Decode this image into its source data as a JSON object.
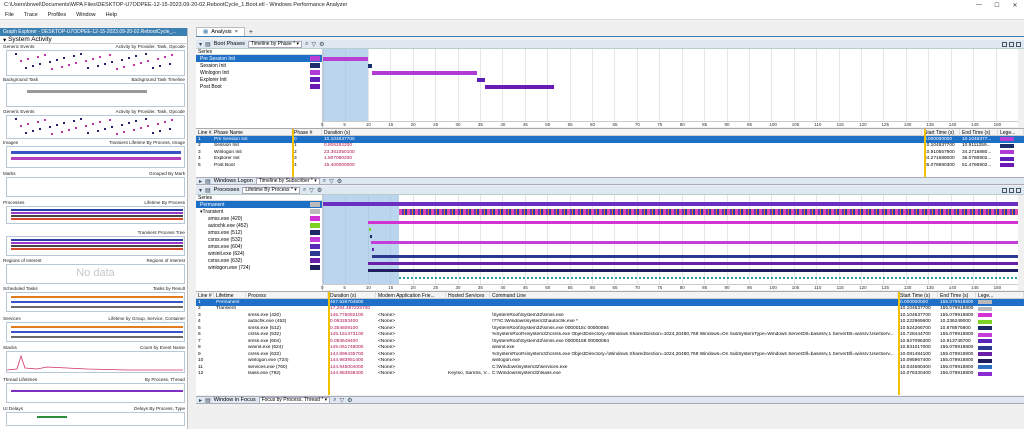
{
  "window": {
    "title": "C:\\Users\\brwel\\Documents\\WPA Files\\DESKTOP-U7ODPEE-12-15-2023.09-20-02.RebootCycle_1.Boot.etl - Windows Performance Analyzer",
    "minimize": "—",
    "maximize": "☐",
    "close": "✕"
  },
  "menu": [
    "File",
    "Trace",
    "Profiles",
    "Window",
    "Help"
  ],
  "graph_explorer": {
    "title": "Graph Explorer - DESKTOP-U7ODPEE-12-15-2023.09-20-02.RebootCycle_...",
    "section": "System Activity",
    "groups": [
      {
        "name": "Generic Events",
        "right": "Activity by Provider, Task, Opcode"
      },
      {
        "name": "Background Task",
        "right": "Background Task Timeline"
      },
      {
        "name": "Generic Events",
        "right": "Activity by Provider, Task, Opcode"
      },
      {
        "name": "Images",
        "right": "Transient Lifetime By Process, Image"
      },
      {
        "name": "Marks",
        "right": "Grouped By Mark"
      },
      {
        "name": "Processes",
        "right": "Lifetime By Process"
      },
      {
        "name": "",
        "right": "Transient Process Tree"
      },
      {
        "name": "Regions of Interest",
        "right": "Regions of Interest"
      },
      {
        "name": "Scheduled Tasks",
        "right": "Tasks by Result"
      },
      {
        "name": "Services",
        "right": "Lifetime by Group, Service, Container"
      },
      {
        "name": "Stacks",
        "right": "Count by Event Name"
      },
      {
        "name": "Thread Lifetimes",
        "right": "By Process, Thread"
      },
      {
        "name": "UI Delays",
        "right": "Delays By Process, Type"
      }
    ],
    "no_data": "No data"
  },
  "analysis_tab": {
    "label": "Analysis",
    "close": "×",
    "add": "+"
  },
  "boot": {
    "title": "Boot Phases",
    "view": "Timeline by Phase *",
    "series_header": "Series",
    "series": [
      {
        "name": "Pre Session Init",
        "color": "#b83fd1"
      },
      {
        "name": "Session Init",
        "color": "#1a2f6b"
      },
      {
        "name": "Winlogon Init",
        "color": "#b03ad6"
      },
      {
        "name": "Explorer Init",
        "color": "#5d1fb8"
      },
      {
        "name": "Post Boot",
        "color": "#6b18b4"
      }
    ],
    "columns": [
      "Line #",
      "Phase Name",
      "Phase #",
      "Duration (s)",
      "Start Time (s)",
      "End Time (s)",
      "Lege..."
    ],
    "rows": [
      {
        "line": "1",
        "name": "Pre Session Init",
        "phase": "0",
        "dur": "10.104637700",
        "start": "0.000000000",
        "end": "10.1046377..."
      },
      {
        "line": "2",
        "name": "Session Init",
        "phase": "1",
        "dur": "0.806282200",
        "start": "10.104637700",
        "end": "10.9111259..."
      },
      {
        "line": "3",
        "name": "Winlogon Init",
        "phase": "2",
        "dur": "23.361050100",
        "start": "10.910557900",
        "end": "34.2716880..."
      },
      {
        "line": "4",
        "name": "Explorer Init",
        "phase": "3",
        "dur": "1.807090200",
        "start": "34.271688000",
        "end": "36.0786902..."
      },
      {
        "line": "5",
        "name": "Post Boot",
        "phase": "4",
        "dur": "15.400000000",
        "start": "36.078690300",
        "end": "51.4786902..."
      }
    ]
  },
  "axis_ticks": [
    "0",
    "5",
    "10",
    "15",
    "20",
    "25",
    "30",
    "35",
    "40",
    "45",
    "50",
    "55",
    "60",
    "65",
    "70",
    "75",
    "80",
    "85",
    "90",
    "95",
    "100",
    "105",
    "110",
    "115",
    "120",
    "125",
    "130",
    "135",
    "140",
    "145",
    "150"
  ],
  "winlogon": {
    "title": "Windows Logon",
    "view": "Timeline by Subscriber *"
  },
  "processes": {
    "title": "Processes",
    "view": "Lifetime By Process *",
    "series_header": "Series",
    "series": [
      {
        "name": "Permanent",
        "color": "#b9b9b9",
        "sel": true
      },
      {
        "name": "Transient",
        "color": "#bbbbbb",
        "tree": true
      },
      {
        "name": "smss.exe (420)",
        "color": "#d233d2"
      },
      {
        "name": "autochk.exe (452)",
        "color": "#7dd321"
      },
      {
        "name": "smss.exe (512)",
        "color": "#1e2a66"
      },
      {
        "name": "csrss.exe (532)",
        "color": "#c43dd8"
      },
      {
        "name": "smss.exe (604)",
        "color": "#5a28b8"
      },
      {
        "name": "wininit.exe (624)",
        "color": "#2b3990"
      },
      {
        "name": "csrss.exe (632)",
        "color": "#6a1fa9"
      },
      {
        "name": "winlogon.exe (724)",
        "color": "#1f1f5f"
      }
    ],
    "columns": [
      "Line #",
      "Lifetime",
      "Process",
      "Duration (s)",
      "Modern Application Frie...",
      "Hosted Services",
      "Command Line",
      "Start Time (s)",
      "End Time (s)",
      "Lege..."
    ],
    "rows": [
      {
        "line": "1",
        "life": "Permanent",
        "proc": "",
        "dur": "467.626704800",
        "app": "",
        "svc": "",
        "cmd": "",
        "start": "0.000000000",
        "end": "155.079918800",
        "sel": true
      },
      {
        "line": "2",
        "life": "Transient",
        "proc": "",
        "dur": "17,284.487225700",
        "app": "",
        "svc": "",
        "cmd": "",
        "start": "10.104637700",
        "end": "155.079918800"
      },
      {
        "line": "3",
        "life": "",
        "proc": "smss.exe (420)",
        "dur": "145.775082100",
        "app": "<None>",
        "svc": "",
        "cmd": "\\SystemRoot\\System32\\smss.exe",
        "start": "10.104637700",
        "end": "155.079918800"
      },
      {
        "line": "4",
        "life": "",
        "proc": "autochk.exe (452)",
        "dur": "0.093283400",
        "app": "<None>",
        "svc": "",
        "cmd": "\\??\\C:\\Windows\\system32\\autochk.exe *",
        "start": "10.222965600",
        "end": "10.236249000"
      },
      {
        "line": "5",
        "life": "",
        "proc": "smss.exe (512)",
        "dur": "0.354609100",
        "app": "<None>",
        "svc": "",
        "cmd": "\\SystemRoot\\System32\\smss.exe 0000015c 00000084",
        "start": "10.524266700",
        "end": "10.878875800"
      },
      {
        "line": "6",
        "life": "",
        "proc": "csrss.exe (532)",
        "dur": "145.151473100",
        "app": "<None>",
        "svc": "",
        "cmd": "%SystemRoot%\\system32\\csrss.exe ObjectDirectory=\\Windows SharedSection=1024,20480,768 Windows=On SubSystemType=Windows ServerDll=basesrv,1 ServerDll=winsrv:UserServ...",
        "start": "10.728444700",
        "end": "155.079918800"
      },
      {
        "line": "7",
        "life": "",
        "proc": "smss.exe (604)",
        "dur": "0.093649400",
        "app": "<None>",
        "svc": "",
        "cmd": "\\SystemRoot\\System32\\smss.exe 00000158 00000084",
        "start": "10.927096300",
        "end": "10.913745700"
      },
      {
        "line": "8",
        "life": "",
        "proc": "wininit.exe (624)",
        "dur": "145.061748000",
        "app": "<None>",
        "svc": "",
        "cmd": "wininit.exe",
        "start": "10.831017000",
        "end": "155.079918800"
      },
      {
        "line": "9",
        "life": "",
        "proc": "csrss.exe (632)",
        "dur": "144.996435700",
        "app": "<None>",
        "svc": "",
        "cmd": "%SystemRoot%\\system32\\csrss.exe ObjectDirectory=\\Windows SharedSection=1024,20480,768 Windows=On SubSystemType=Windows ServerDll=basesrv,1 ServerDll=winsrv:UserServ...",
        "start": "10.081484100",
        "end": "155.079918800"
      },
      {
        "line": "10",
        "life": "",
        "proc": "winlogon.exe (724)",
        "dur": "144.983951400",
        "app": "<None>",
        "svc": "",
        "cmd": "winlogon.exe",
        "start": "10.095967400",
        "end": "155.079918800"
      },
      {
        "line": "11",
        "life": "",
        "proc": "services.exe (760)",
        "dur": "144.945004000",
        "app": "<None>",
        "svc": "",
        "cmd": "C:\\Windows\\system32\\services.exe",
        "start": "10.034680400",
        "end": "155.079918800"
      },
      {
        "line": "12",
        "life": "",
        "proc": "lsass.exe (792)",
        "dur": "144.983938400",
        "app": "<None>",
        "svc": "KeyIso, SamSs, V...",
        "cmd": "C:\\Windows\\system32\\lsass.exe",
        "start": "10.076330400",
        "end": "155.079918800"
      }
    ]
  },
  "focus": {
    "title": "Window in Focus",
    "view": "Focus by Process, Thread *"
  }
}
